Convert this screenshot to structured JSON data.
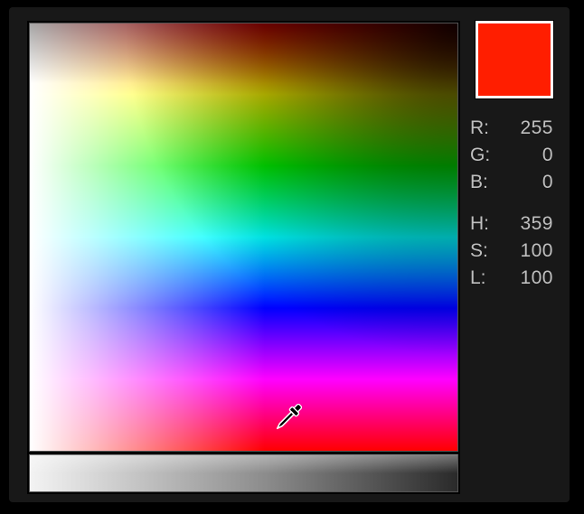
{
  "swatch_color": "#ff1e00",
  "labels": {
    "r": "R:",
    "g": "G:",
    "b": "B:",
    "h": "H:",
    "s": "S:",
    "l": "L:"
  },
  "values": {
    "r": "255",
    "g": "0",
    "b": "0",
    "h": "359",
    "s": "100",
    "l": "100"
  }
}
